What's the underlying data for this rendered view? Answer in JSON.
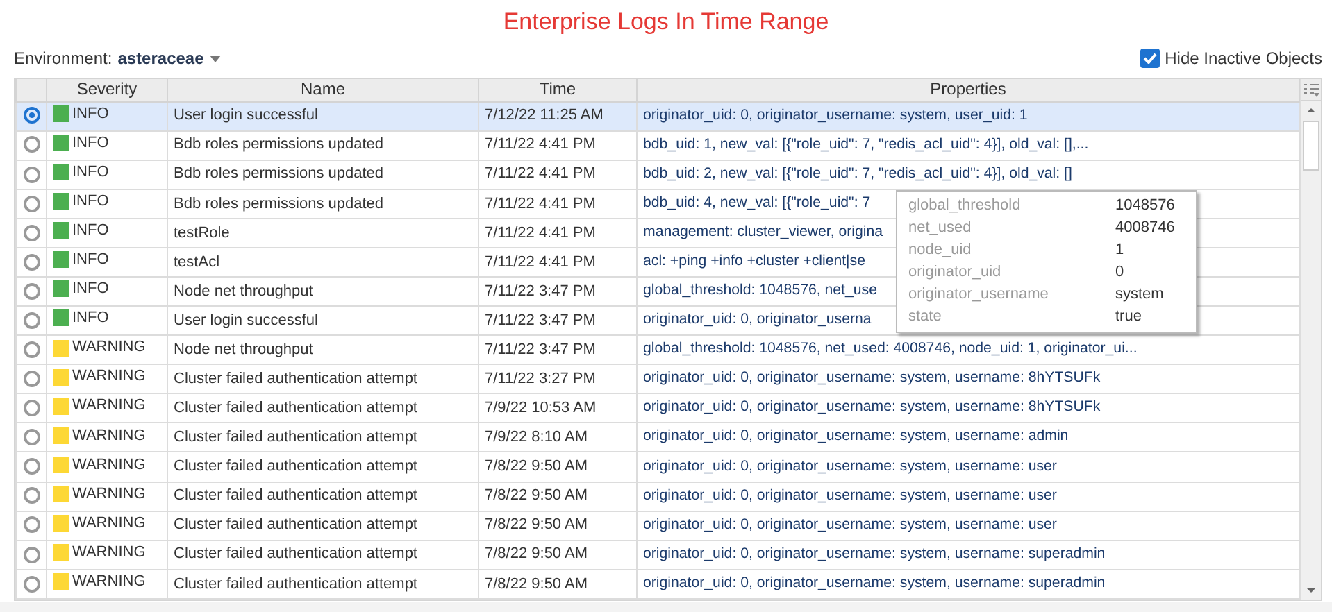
{
  "title": "Enterprise Logs In Time Range",
  "environment": {
    "label": "Environment:",
    "value": "asteraceae"
  },
  "hide_inactive": {
    "label": "Hide Inactive Objects",
    "checked": true
  },
  "table": {
    "columns": [
      "Severity",
      "Name",
      "Time",
      "Properties"
    ],
    "rows": [
      {
        "selected": true,
        "severity": "INFO",
        "color": "#4caf50",
        "name": "User login successful",
        "time": "7/12/22 11:25 AM",
        "properties": "originator_uid: 0, originator_username: system, user_uid: 1"
      },
      {
        "selected": false,
        "severity": "INFO",
        "color": "#4caf50",
        "name": "Bdb roles permissions updated",
        "time": "7/11/22 4:41 PM",
        "properties": "bdb_uid: 1, new_val: [{\"role_uid\": 7, \"redis_acl_uid\": 4}], old_val: [],..."
      },
      {
        "selected": false,
        "severity": "INFO",
        "color": "#4caf50",
        "name": "Bdb roles permissions updated",
        "time": "7/11/22 4:41 PM",
        "properties": "bdb_uid: 2, new_val: [{\"role_uid\": 7, \"redis_acl_uid\": 4}], old_val: []"
      },
      {
        "selected": false,
        "severity": "INFO",
        "color": "#4caf50",
        "name": "Bdb roles permissions updated",
        "time": "7/11/22 4:41 PM",
        "properties": "bdb_uid: 4, new_val: [{\"role_uid\": 7"
      },
      {
        "selected": false,
        "severity": "INFO",
        "color": "#4caf50",
        "name": "testRole",
        "time": "7/11/22 4:41 PM",
        "properties": "management: cluster_viewer, origina"
      },
      {
        "selected": false,
        "severity": "INFO",
        "color": "#4caf50",
        "name": "testAcl",
        "time": "7/11/22 4:41 PM",
        "properties": "acl: +ping +info +cluster +client|se"
      },
      {
        "selected": false,
        "severity": "INFO",
        "color": "#4caf50",
        "name": "Node net throughput",
        "time": "7/11/22 3:47 PM",
        "properties": "global_threshold: 1048576, net_use"
      },
      {
        "selected": false,
        "severity": "INFO",
        "color": "#4caf50",
        "name": "User login successful",
        "time": "7/11/22 3:47 PM",
        "properties": "originator_uid: 0, originator_userna"
      },
      {
        "selected": false,
        "severity": "WARNING",
        "color": "#fdd835",
        "name": "Node net throughput",
        "time": "7/11/22 3:47 PM",
        "properties": "global_threshold: 1048576, net_used: 4008746, node_uid: 1, originator_ui..."
      },
      {
        "selected": false,
        "severity": "WARNING",
        "color": "#fdd835",
        "name": "Cluster failed authentication attempt",
        "time": "7/11/22 3:27 PM",
        "properties": "originator_uid: 0, originator_username: system, username: 8hYTSUFk"
      },
      {
        "selected": false,
        "severity": "WARNING",
        "color": "#fdd835",
        "name": "Cluster failed authentication attempt",
        "time": "7/9/22 10:53 AM",
        "properties": "originator_uid: 0, originator_username: system, username: 8hYTSUFk"
      },
      {
        "selected": false,
        "severity": "WARNING",
        "color": "#fdd835",
        "name": "Cluster failed authentication attempt",
        "time": "7/9/22 8:10 AM",
        "properties": "originator_uid: 0, originator_username: system, username: admin"
      },
      {
        "selected": false,
        "severity": "WARNING",
        "color": "#fdd835",
        "name": "Cluster failed authentication attempt",
        "time": "7/8/22 9:50 AM",
        "properties": "originator_uid: 0, originator_username: system, username: user"
      },
      {
        "selected": false,
        "severity": "WARNING",
        "color": "#fdd835",
        "name": "Cluster failed authentication attempt",
        "time": "7/8/22 9:50 AM",
        "properties": "originator_uid: 0, originator_username: system, username: user"
      },
      {
        "selected": false,
        "severity": "WARNING",
        "color": "#fdd835",
        "name": "Cluster failed authentication attempt",
        "time": "7/8/22 9:50 AM",
        "properties": "originator_uid: 0, originator_username: system, username: user"
      },
      {
        "selected": false,
        "severity": "WARNING",
        "color": "#fdd835",
        "name": "Cluster failed authentication attempt",
        "time": "7/8/22 9:50 AM",
        "properties": "originator_uid: 0, originator_username: system, username: superadmin"
      },
      {
        "selected": false,
        "severity": "WARNING",
        "color": "#fdd835",
        "name": "Cluster failed authentication attempt",
        "time": "7/8/22 9:50 AM",
        "properties": "originator_uid: 0, originator_username: system, username: superadmin"
      }
    ]
  },
  "tooltip": {
    "entries": [
      {
        "key": "global_threshold",
        "value": "1048576"
      },
      {
        "key": "net_used",
        "value": "4008746"
      },
      {
        "key": "node_uid",
        "value": "1"
      },
      {
        "key": "originator_uid",
        "value": "0"
      },
      {
        "key": "originator_username",
        "value": "system"
      },
      {
        "key": "state",
        "value": "true"
      }
    ]
  }
}
